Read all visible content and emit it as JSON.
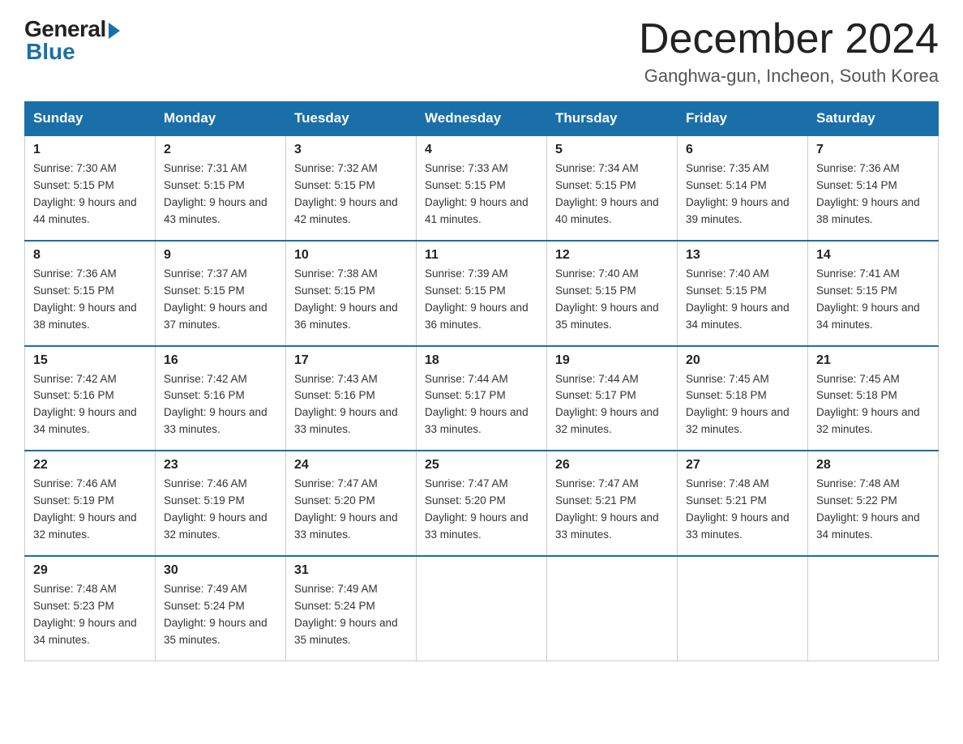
{
  "logo": {
    "general": "General",
    "blue": "Blue"
  },
  "header": {
    "month_title": "December 2024",
    "location": "Ganghwa-gun, Incheon, South Korea"
  },
  "weekdays": [
    "Sunday",
    "Monday",
    "Tuesday",
    "Wednesday",
    "Thursday",
    "Friday",
    "Saturday"
  ],
  "weeks": [
    [
      {
        "day": "1",
        "sunrise": "7:30 AM",
        "sunset": "5:15 PM",
        "daylight": "9 hours and 44 minutes."
      },
      {
        "day": "2",
        "sunrise": "7:31 AM",
        "sunset": "5:15 PM",
        "daylight": "9 hours and 43 minutes."
      },
      {
        "day": "3",
        "sunrise": "7:32 AM",
        "sunset": "5:15 PM",
        "daylight": "9 hours and 42 minutes."
      },
      {
        "day": "4",
        "sunrise": "7:33 AM",
        "sunset": "5:15 PM",
        "daylight": "9 hours and 41 minutes."
      },
      {
        "day": "5",
        "sunrise": "7:34 AM",
        "sunset": "5:15 PM",
        "daylight": "9 hours and 40 minutes."
      },
      {
        "day": "6",
        "sunrise": "7:35 AM",
        "sunset": "5:14 PM",
        "daylight": "9 hours and 39 minutes."
      },
      {
        "day": "7",
        "sunrise": "7:36 AM",
        "sunset": "5:14 PM",
        "daylight": "9 hours and 38 minutes."
      }
    ],
    [
      {
        "day": "8",
        "sunrise": "7:36 AM",
        "sunset": "5:15 PM",
        "daylight": "9 hours and 38 minutes."
      },
      {
        "day": "9",
        "sunrise": "7:37 AM",
        "sunset": "5:15 PM",
        "daylight": "9 hours and 37 minutes."
      },
      {
        "day": "10",
        "sunrise": "7:38 AM",
        "sunset": "5:15 PM",
        "daylight": "9 hours and 36 minutes."
      },
      {
        "day": "11",
        "sunrise": "7:39 AM",
        "sunset": "5:15 PM",
        "daylight": "9 hours and 36 minutes."
      },
      {
        "day": "12",
        "sunrise": "7:40 AM",
        "sunset": "5:15 PM",
        "daylight": "9 hours and 35 minutes."
      },
      {
        "day": "13",
        "sunrise": "7:40 AM",
        "sunset": "5:15 PM",
        "daylight": "9 hours and 34 minutes."
      },
      {
        "day": "14",
        "sunrise": "7:41 AM",
        "sunset": "5:15 PM",
        "daylight": "9 hours and 34 minutes."
      }
    ],
    [
      {
        "day": "15",
        "sunrise": "7:42 AM",
        "sunset": "5:16 PM",
        "daylight": "9 hours and 34 minutes."
      },
      {
        "day": "16",
        "sunrise": "7:42 AM",
        "sunset": "5:16 PM",
        "daylight": "9 hours and 33 minutes."
      },
      {
        "day": "17",
        "sunrise": "7:43 AM",
        "sunset": "5:16 PM",
        "daylight": "9 hours and 33 minutes."
      },
      {
        "day": "18",
        "sunrise": "7:44 AM",
        "sunset": "5:17 PM",
        "daylight": "9 hours and 33 minutes."
      },
      {
        "day": "19",
        "sunrise": "7:44 AM",
        "sunset": "5:17 PM",
        "daylight": "9 hours and 32 minutes."
      },
      {
        "day": "20",
        "sunrise": "7:45 AM",
        "sunset": "5:18 PM",
        "daylight": "9 hours and 32 minutes."
      },
      {
        "day": "21",
        "sunrise": "7:45 AM",
        "sunset": "5:18 PM",
        "daylight": "9 hours and 32 minutes."
      }
    ],
    [
      {
        "day": "22",
        "sunrise": "7:46 AM",
        "sunset": "5:19 PM",
        "daylight": "9 hours and 32 minutes."
      },
      {
        "day": "23",
        "sunrise": "7:46 AM",
        "sunset": "5:19 PM",
        "daylight": "9 hours and 32 minutes."
      },
      {
        "day": "24",
        "sunrise": "7:47 AM",
        "sunset": "5:20 PM",
        "daylight": "9 hours and 33 minutes."
      },
      {
        "day": "25",
        "sunrise": "7:47 AM",
        "sunset": "5:20 PM",
        "daylight": "9 hours and 33 minutes."
      },
      {
        "day": "26",
        "sunrise": "7:47 AM",
        "sunset": "5:21 PM",
        "daylight": "9 hours and 33 minutes."
      },
      {
        "day": "27",
        "sunrise": "7:48 AM",
        "sunset": "5:21 PM",
        "daylight": "9 hours and 33 minutes."
      },
      {
        "day": "28",
        "sunrise": "7:48 AM",
        "sunset": "5:22 PM",
        "daylight": "9 hours and 34 minutes."
      }
    ],
    [
      {
        "day": "29",
        "sunrise": "7:48 AM",
        "sunset": "5:23 PM",
        "daylight": "9 hours and 34 minutes."
      },
      {
        "day": "30",
        "sunrise": "7:49 AM",
        "sunset": "5:24 PM",
        "daylight": "9 hours and 35 minutes."
      },
      {
        "day": "31",
        "sunrise": "7:49 AM",
        "sunset": "5:24 PM",
        "daylight": "9 hours and 35 minutes."
      },
      null,
      null,
      null,
      null
    ]
  ]
}
